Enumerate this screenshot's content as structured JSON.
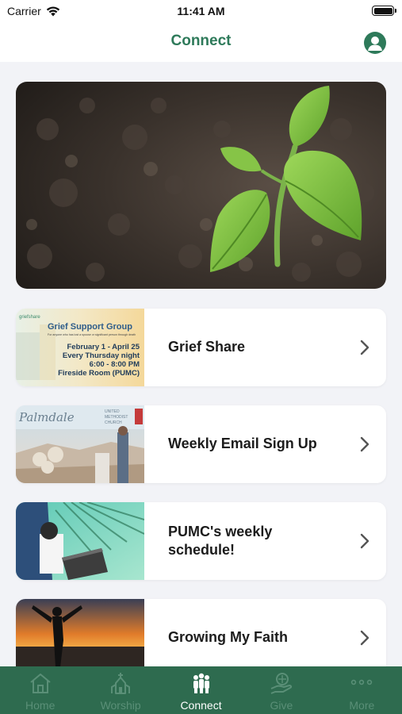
{
  "status": {
    "carrier": "Carrier",
    "time": "11:41 AM"
  },
  "nav": {
    "title": "Connect"
  },
  "hero": {
    "image": "seedling-in-soil-photo"
  },
  "cards": [
    {
      "label": "Grief Share",
      "thumb": {
        "title": "Grief Support Group",
        "subtitle": "For anyone who has lost a spouse or significant person through death",
        "line1": "February 1 - April 25",
        "line2": "Every Thursday night",
        "line3": "6:00 - 8:00 PM",
        "line4": "Fireside Room (PUMC)"
      }
    },
    {
      "label": "Weekly Email Sign Up",
      "thumb": {
        "script": "Palmdale",
        "line1": "UNITED",
        "line2": "METHODIST",
        "line3": "CHURCH"
      }
    },
    {
      "label": "PUMC's weekly schedule!",
      "thumb": {}
    },
    {
      "label": "Growing My Faith",
      "thumb": {}
    }
  ],
  "tabs": [
    {
      "label": "Home",
      "icon": "house-icon"
    },
    {
      "label": "Worship",
      "icon": "church-icon"
    },
    {
      "label": "Connect",
      "icon": "people-icon"
    },
    {
      "label": "Give",
      "icon": "giving-hand-icon"
    },
    {
      "label": "More",
      "icon": "more-dots-icon"
    }
  ],
  "colors": {
    "accent": "#2e7a5a",
    "tab_bar": "#2e6b4f",
    "background": "#f2f3f7"
  }
}
